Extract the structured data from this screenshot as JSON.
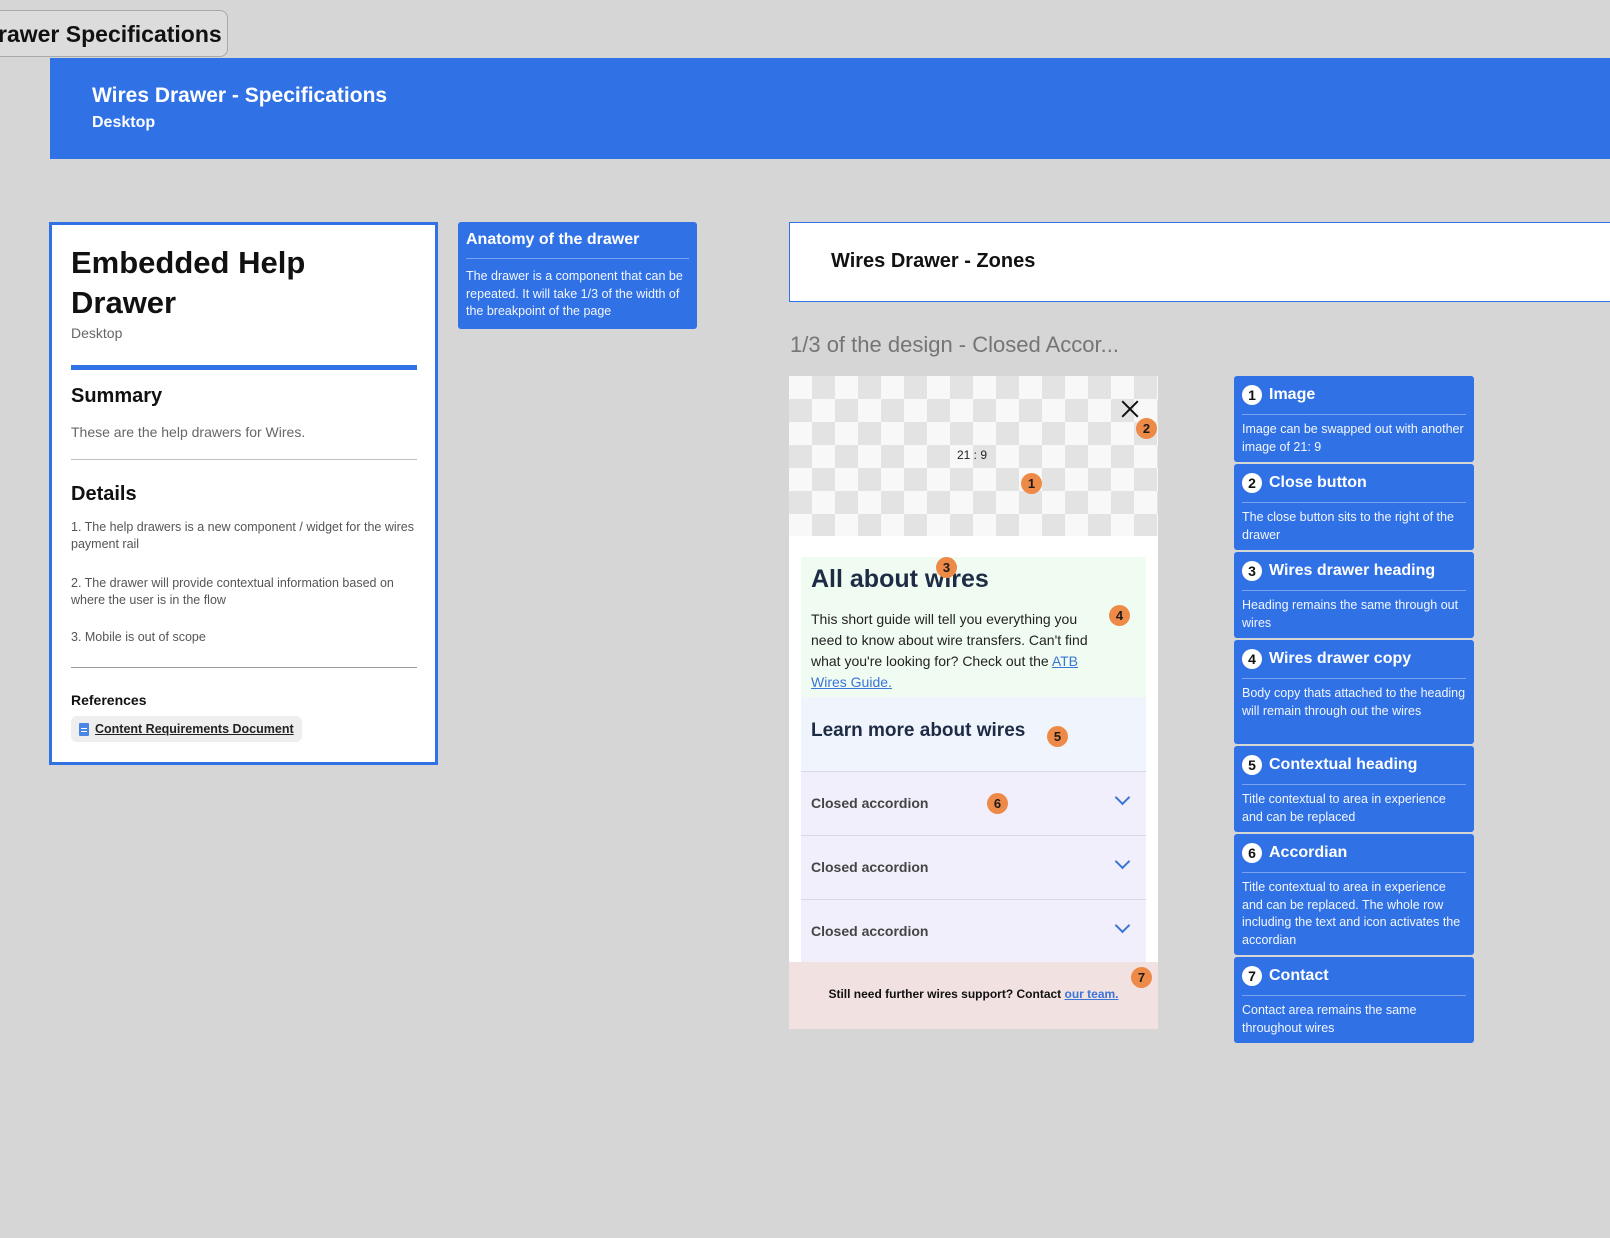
{
  "frame_tab": "rawer Specifications",
  "banner": {
    "title": "Wires Drawer - Specifications",
    "subtitle": "Desktop"
  },
  "spec": {
    "title": "Embedded Help Drawer",
    "platform": "Desktop",
    "summary_heading": "Summary",
    "summary_text": "These are the help drawers for Wires.",
    "details_heading": "Details",
    "details": [
      "1. The help drawers is a new component / widget for the wires payment rail",
      "2. The drawer will provide contextual information based on where the user is in the flow",
      "3. Mobile is out of scope"
    ],
    "references_label": "References",
    "reference_doc": "Content Requirements Document"
  },
  "anatomy_note": {
    "title": "Anatomy of the drawer",
    "body": "The drawer is a component that can be repeated. It  will take 1/3 of the width of the breakpoint of the page"
  },
  "zones": {
    "title": "Wires Drawer - Zones",
    "subtitle": "1/3 of the design - Closed Accor..."
  },
  "drawer": {
    "ratio": "21 : 9",
    "heading": "All about wires",
    "copy": "This short guide will tell you everything you need to know about wire transfers. Can't find what you're looking for? Check out the ",
    "copy_link": "ATB Wires Guide.",
    "contextual_heading": "Learn more about wires",
    "accordions": [
      "Closed accordion",
      "Closed accordion",
      "Closed accordion"
    ],
    "contact_text": "Still need further wires support? Contact ",
    "contact_link": "our team."
  },
  "markers": [
    "1",
    "2",
    "3",
    "4",
    "5",
    "6",
    "7"
  ],
  "legend": [
    {
      "num": "1",
      "title": "Image",
      "body": "Image can be swapped out with another image of 21: 9"
    },
    {
      "num": "2",
      "title": "Close button",
      "body": "The close button sits to the right of the drawer"
    },
    {
      "num": "3",
      "title": "Wires drawer heading",
      "body": "Heading remains the same through out wires"
    },
    {
      "num": "4",
      "title": "Wires drawer copy",
      "body": "Body copy thats attached to the heading will remain through out the wires"
    },
    {
      "num": "5",
      "title": "Contextual heading",
      "body": "Title contextual to area in experience and can be replaced"
    },
    {
      "num": "6",
      "title": "Accordian",
      "body": "Title contextual to area in experience and can be replaced. The whole row including the text and icon activates the accordian"
    },
    {
      "num": "7",
      "title": "Contact",
      "body": "Contact area remains the same throughout wires"
    }
  ],
  "colors": {
    "accent": "#3072e6",
    "marker": "#ee8a47",
    "canvas": "#d6d6d6"
  }
}
